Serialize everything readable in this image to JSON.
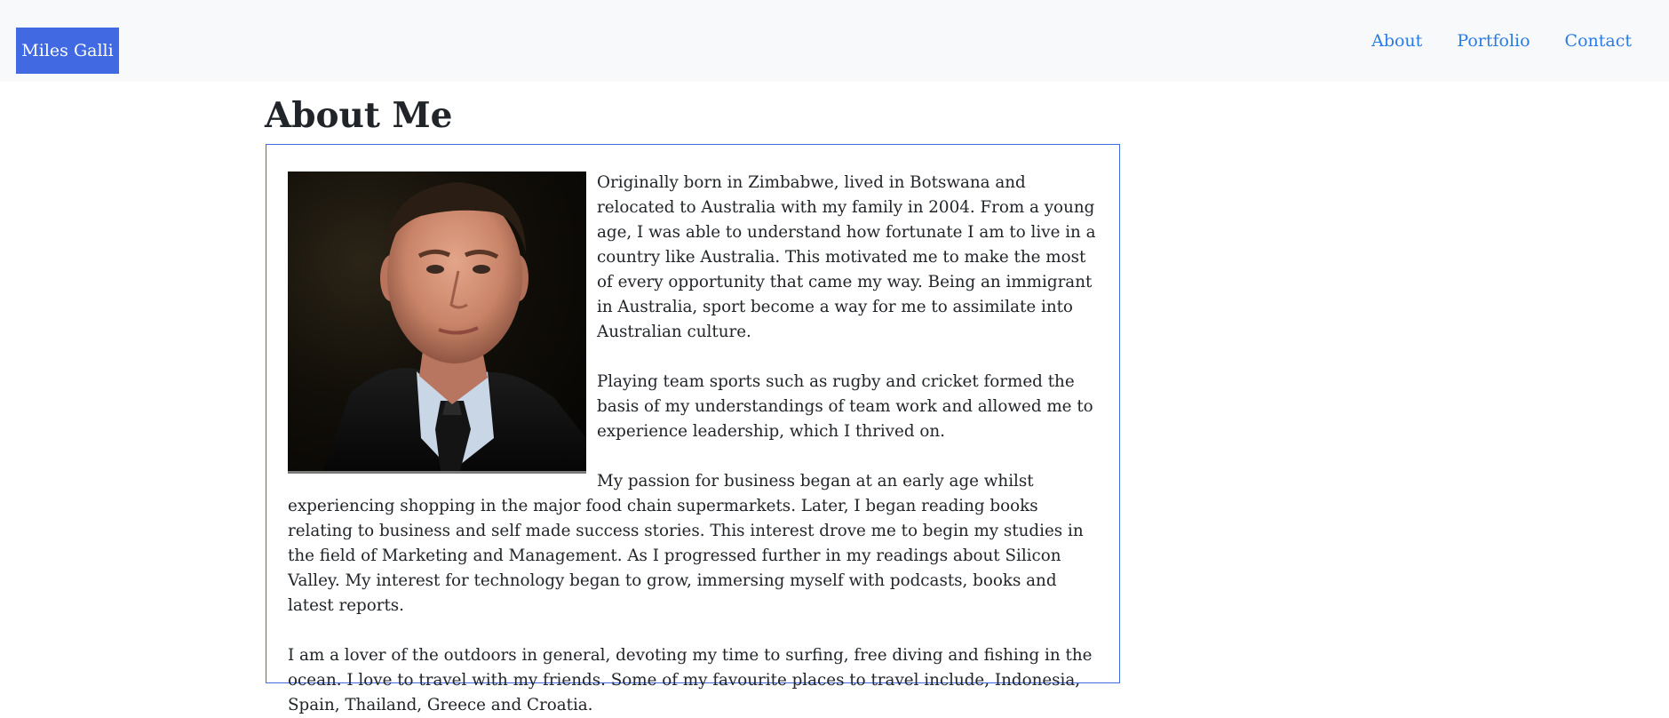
{
  "navbar": {
    "brand": "Miles Galli",
    "links": [
      "About",
      "Portfolio",
      "Contact"
    ]
  },
  "main": {
    "title": "About Me",
    "paragraphs": [
      "Originally born in Zimbabwe, lived in Botswana and relocated to Australia with my family in 2004. From a young age, I was able to understand how fortunate I am to live in a country like Australia. This motivated me to make the most of every opportunity that came my way. Being an immigrant in Australia, sport become a way for me to assimilate into Australian culture.",
      "Playing team sports such as rugby and cricket formed the basis of my understandings of team work and allowed me to experience leadership, which I thrived on.",
      "My passion for business began at an early age whilst experiencing shopping in the major food chain supermarkets. Later, I began reading books relating to business and self made success stories. This interest drove me to begin my studies in the field of Marketing and Management. As I progressed further in my readings about Silicon Valley. My interest for technology began to grow, immersing myself with podcasts, books and latest reports.",
      "I am a lover of the outdoors in general, devoting my time to surfing, free diving and fishing in the ocean. I love to travel with my friends. Some of my favourite places to travel include, Indonesia, Spain, Thailand, Greece and Croatia."
    ]
  },
  "colors": {
    "brand_bg": "#4169e1",
    "nav_link": "#2a7be4",
    "navbar_bg": "#f8f9fa",
    "box_border": "#4169e1"
  }
}
